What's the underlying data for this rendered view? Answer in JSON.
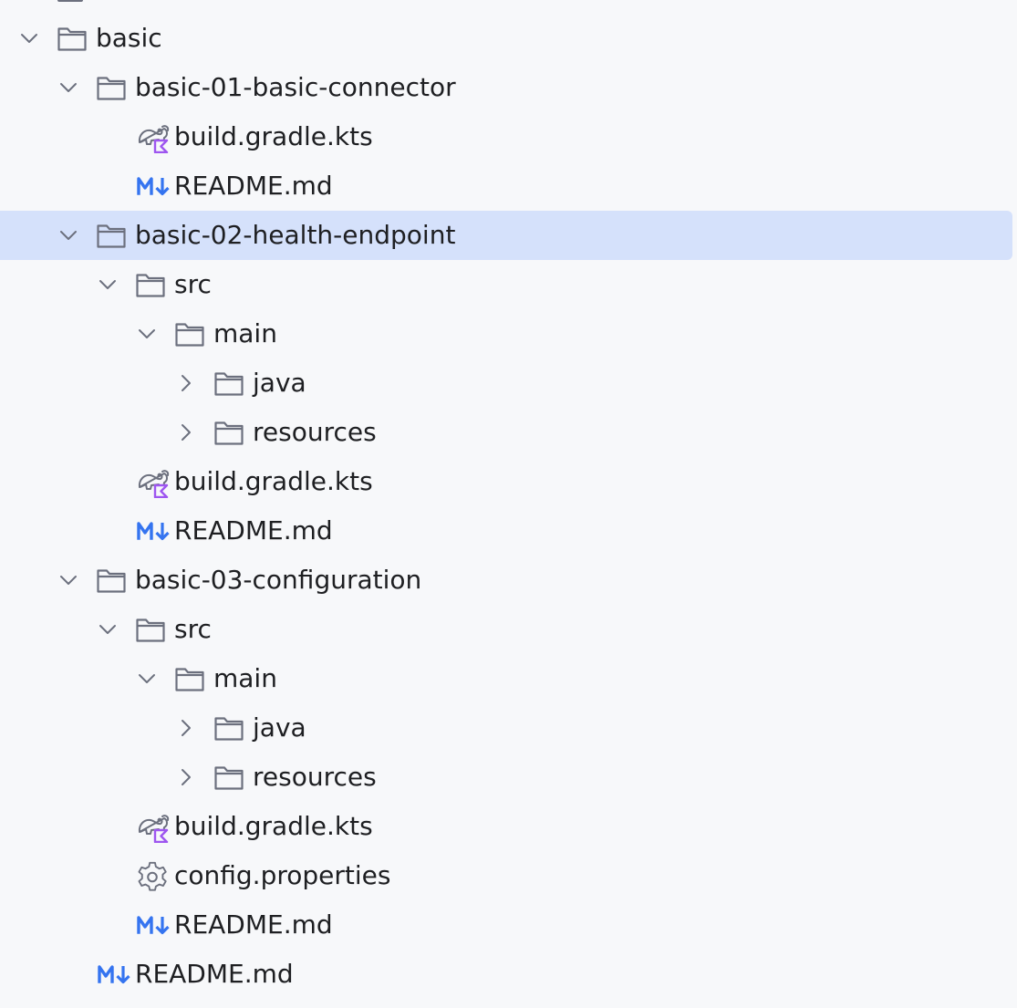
{
  "tree": {
    "rows": [
      {
        "label": "basic",
        "type": "folder",
        "depth": 0,
        "expandable": true,
        "expanded": true,
        "selected": false
      },
      {
        "label": "basic-01-basic-connector",
        "type": "folder",
        "depth": 1,
        "expandable": true,
        "expanded": true,
        "selected": false
      },
      {
        "label": "build.gradle.kts",
        "type": "gradle-kotlin",
        "depth": 2,
        "expandable": false,
        "expanded": false,
        "selected": false
      },
      {
        "label": "README.md",
        "type": "markdown",
        "depth": 2,
        "expandable": false,
        "expanded": false,
        "selected": false
      },
      {
        "label": "basic-02-health-endpoint",
        "type": "folder",
        "depth": 1,
        "expandable": true,
        "expanded": true,
        "selected": true
      },
      {
        "label": "src",
        "type": "folder",
        "depth": 2,
        "expandable": true,
        "expanded": true,
        "selected": false
      },
      {
        "label": "main",
        "type": "folder",
        "depth": 3,
        "expandable": true,
        "expanded": true,
        "selected": false
      },
      {
        "label": "java",
        "type": "folder",
        "depth": 4,
        "expandable": true,
        "expanded": false,
        "selected": false
      },
      {
        "label": "resources",
        "type": "folder",
        "depth": 4,
        "expandable": true,
        "expanded": false,
        "selected": false
      },
      {
        "label": "build.gradle.kts",
        "type": "gradle-kotlin",
        "depth": 2,
        "expandable": false,
        "expanded": false,
        "selected": false
      },
      {
        "label": "README.md",
        "type": "markdown",
        "depth": 2,
        "expandable": false,
        "expanded": false,
        "selected": false
      },
      {
        "label": "basic-03-configuration",
        "type": "folder",
        "depth": 1,
        "expandable": true,
        "expanded": true,
        "selected": false
      },
      {
        "label": "src",
        "type": "folder",
        "depth": 2,
        "expandable": true,
        "expanded": true,
        "selected": false
      },
      {
        "label": "main",
        "type": "folder",
        "depth": 3,
        "expandable": true,
        "expanded": true,
        "selected": false
      },
      {
        "label": "java",
        "type": "folder",
        "depth": 4,
        "expandable": true,
        "expanded": false,
        "selected": false
      },
      {
        "label": "resources",
        "type": "folder",
        "depth": 4,
        "expandable": true,
        "expanded": false,
        "selected": false
      },
      {
        "label": "build.gradle.kts",
        "type": "gradle-kotlin",
        "depth": 2,
        "expandable": false,
        "expanded": false,
        "selected": false
      },
      {
        "label": "config.properties",
        "type": "properties",
        "depth": 2,
        "expandable": false,
        "expanded": false,
        "selected": false
      },
      {
        "label": "README.md",
        "type": "markdown",
        "depth": 2,
        "expandable": false,
        "expanded": false,
        "selected": false
      },
      {
        "label": "README.md",
        "type": "markdown",
        "depth": 1,
        "expandable": false,
        "expanded": false,
        "selected": false
      }
    ]
  },
  "colors": {
    "background": "#f7f8fa",
    "selection": "#d5e1fb",
    "text": "#1e1f22",
    "chevron": "#6c707e",
    "folder_stroke": "#6c707e",
    "markdown_blue": "#3574f0",
    "gradle_gray": "#6c707e",
    "kotlin_purple": "#9e56f0"
  },
  "icons": {
    "folder": "folder-icon",
    "gradle-kotlin": "gradle-kotlin-icon",
    "markdown": "markdown-icon",
    "properties": "gear-icon",
    "chevron_expanded": "chevron-down-icon",
    "chevron_collapsed": "chevron-right-icon"
  }
}
